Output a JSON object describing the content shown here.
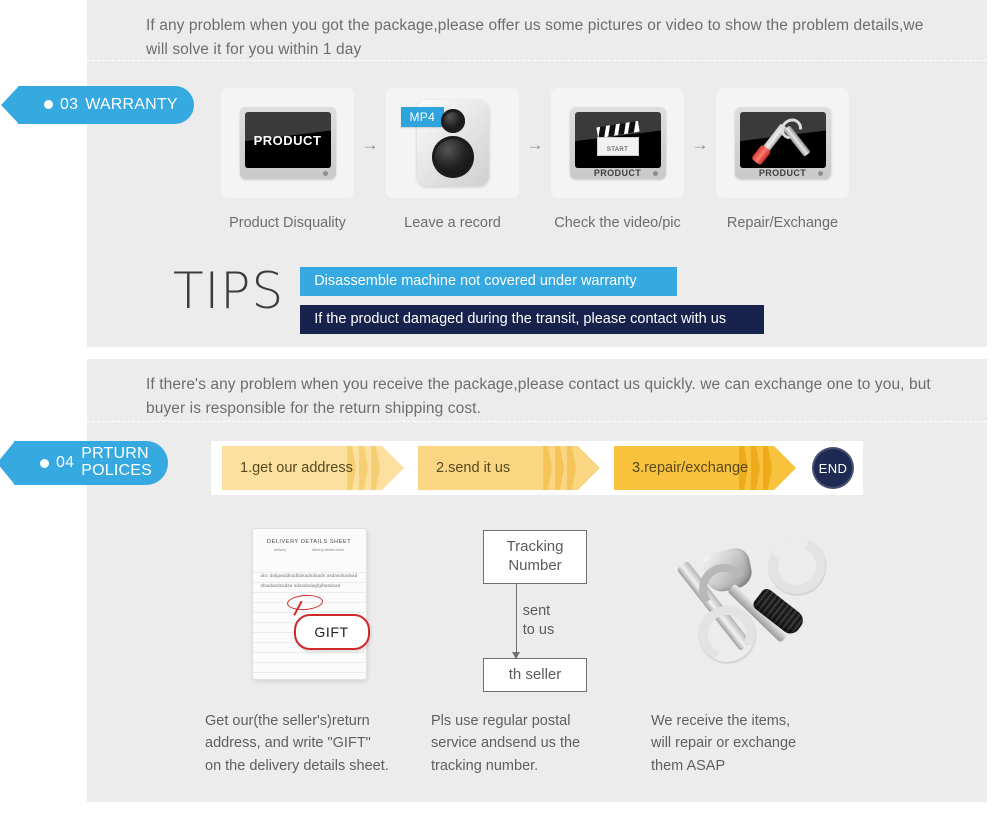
{
  "colors": {
    "accent_blue": "#35a9e0",
    "dark_navy": "#17234d",
    "end_badge": "#1e2a52",
    "panel_grey": "#ececec",
    "arrow_light": "#fbe0a0",
    "arrow_mid": "#fbd682",
    "arrow_dark": "#f8c23c",
    "red_ring": "#cf2a2a"
  },
  "warranty_section": {
    "tag": {
      "number": "03",
      "label": "WARRANTY"
    },
    "intro": "If any problem when you got the package,please offer us some pictures or video to show the problem details,we will solve it for you within 1 day",
    "steps": [
      {
        "label": "Product Disquality",
        "icon": "monitor-icon",
        "screen_text": "PRODUCT"
      },
      {
        "label": "Leave a record",
        "icon": "mp4-recorder-icon",
        "badge": "MP4"
      },
      {
        "label": "Check the video/pic",
        "icon": "clapperboard-monitor-icon",
        "base_text": "PRODUCT",
        "clapper_text": "START"
      },
      {
        "label": "Repair/Exchange",
        "icon": "tools-monitor-icon",
        "base_text": "PRODUCT"
      }
    ],
    "step_arrow": "→",
    "tips": {
      "heading": "TIPS",
      "bars": [
        "Disassemble machine not covered under warranty",
        "If the product damaged during the transit, please contact with us"
      ]
    }
  },
  "returns_section": {
    "tag": {
      "number": "04",
      "label_line1": "PRTURN",
      "label_line2": "POLICES"
    },
    "intro": "If  there's any problem when you receive the package,please contact us quickly. we can exchange one to you, but buyer is responsible for the return shipping cost.",
    "flow_steps": [
      "1.get our address",
      "2.send it us",
      "3.repair/exchange"
    ],
    "end_badge": "END",
    "columns": [
      {
        "art": "delivery-details-sheet",
        "sheet_title": "DELIVERY DETAILS SHEET",
        "sheet_sub_left": "delivery",
        "sheet_sub_right": "delivery details sheet",
        "sheet_body": "abc dafgasddsadbdsadsdsads asdasdsadsadsfsadasdsadsa sdasdsdagfgiftasdsad",
        "callout": "GIFT",
        "caption": "Get our(the seller's)return\naddress, and write \"GIFT\"\non the delivery details sheet."
      },
      {
        "art": "tracking-flow",
        "box_top": "Tracking\nNumber",
        "arrow_label": "sent\nto us",
        "box_bottom": "th seller",
        "caption": "Pls use regular postal\nservice andsend us the\n tracking number."
      },
      {
        "art": "hammer-wrench-screwdriver",
        "caption": "We receive the items,\nwill repair or exchange\n them ASAP"
      }
    ]
  }
}
